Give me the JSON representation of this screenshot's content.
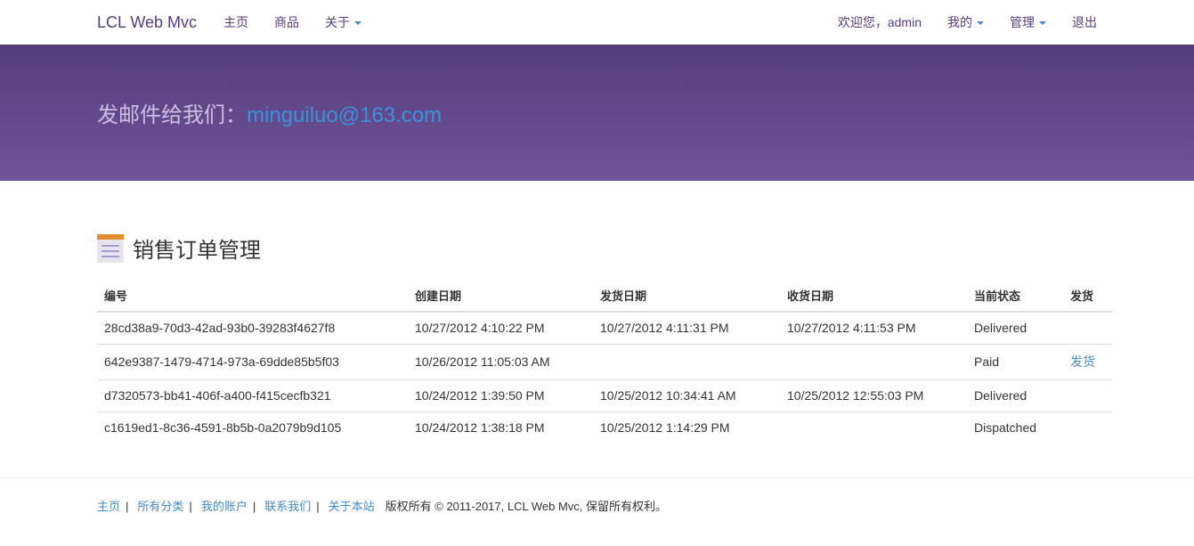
{
  "nav": {
    "brand": "LCL Web Mvc",
    "home": "主页",
    "products": "商品",
    "about": "关于",
    "welcome": "欢迎您，admin",
    "mine": "我的",
    "manage": "管理",
    "logout": "退出"
  },
  "banner": {
    "label": "发邮件给我们：",
    "email": "minguiluo@163.com"
  },
  "page": {
    "title": "销售订单管理"
  },
  "table": {
    "headers": [
      "编号",
      "创建日期",
      "发货日期",
      "收货日期",
      "当前状态",
      "发货"
    ],
    "rows": [
      [
        "28cd38a9-70d3-42ad-93b0-39283f4627f8",
        "10/27/2012 4:10:22 PM",
        "10/27/2012 4:11:31 PM",
        "10/27/2012 4:11:53 PM",
        "Delivered",
        ""
      ],
      [
        "642e9387-1479-4714-973a-69dde85b5f03",
        "10/26/2012 11:05:03 AM",
        "",
        "",
        "Paid",
        "发货"
      ],
      [
        "d7320573-bb41-406f-a400-f415cecfb321",
        "10/24/2012 1:39:50 PM",
        "10/25/2012 10:34:41 AM",
        "10/25/2012 12:55:03 PM",
        "Delivered",
        ""
      ],
      [
        "c1619ed1-8c36-4591-8b5b-0a2079b9d105",
        "10/24/2012 1:38:18 PM",
        "10/25/2012 1:14:29 PM",
        "",
        "Dispatched",
        ""
      ]
    ]
  },
  "footer": {
    "links": [
      "主页",
      "所有分类",
      "我的账户",
      "联系我们",
      "关于本站"
    ],
    "sep": "|",
    "copyright": "版权所有 © 2011-2017, LCL Web Mvc, 保留所有权利。"
  }
}
